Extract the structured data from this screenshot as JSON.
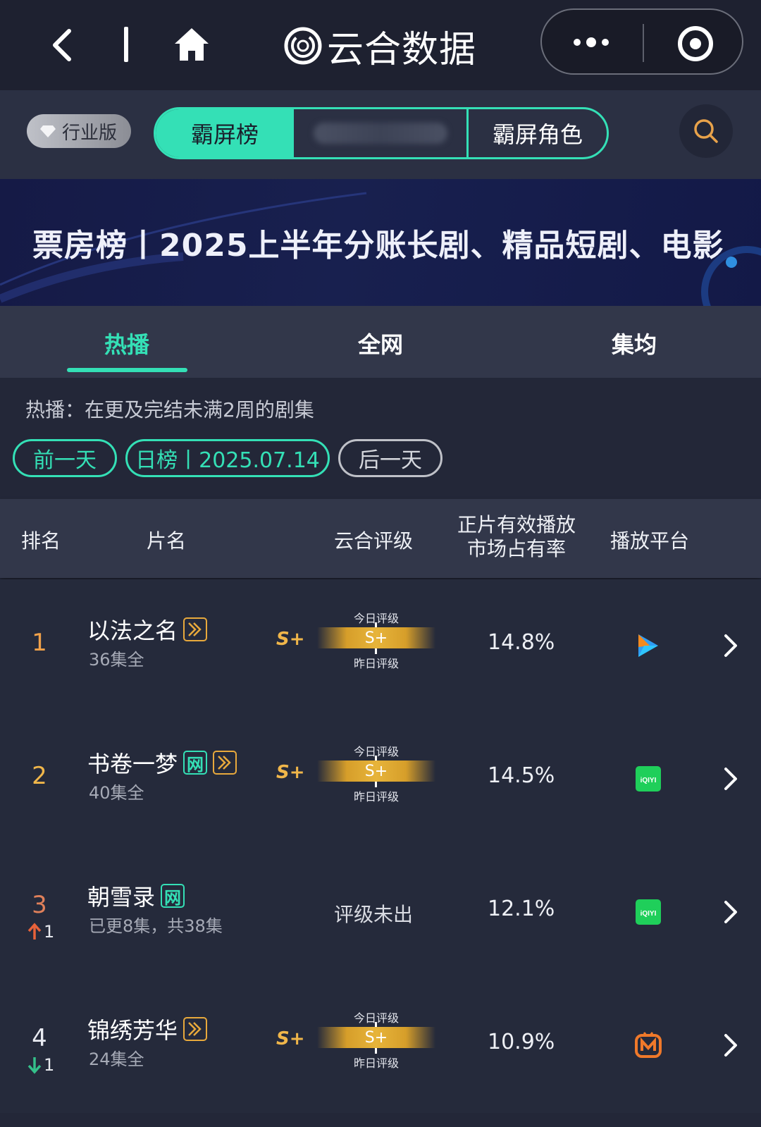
{
  "nav": {
    "app_title": "云合数据"
  },
  "filter": {
    "edition_label": "行业版",
    "segments": [
      "霸屏榜",
      "",
      "霸屏角色"
    ]
  },
  "banner": {
    "text": "票房榜丨2025上半年分账长剧、精品短剧、电影"
  },
  "tabs": [
    "热播",
    "全网",
    "集均"
  ],
  "active_tab": "热播",
  "description": "热播：在更及完结未满2周的剧集",
  "date_nav": {
    "prev_label": "前一天",
    "current_label": "日榜丨2025.07.14",
    "next_label": "后一天"
  },
  "table": {
    "headers": {
      "rank": "排名",
      "title": "片名",
      "rating": "云合评级",
      "share_line1": "正片有效播放",
      "share_line2": "市场占有率",
      "platform": "播放平台"
    },
    "today_label": "今日评级",
    "yesterday_label": "昨日评级",
    "rows": [
      {
        "rank": "1",
        "title": "以法之名",
        "tags": [
          "vip"
        ],
        "episodes": "36集全",
        "grade": "S+",
        "bar_grade": "S+",
        "share": "14.8%",
        "platform": "tencent-video-icon",
        "change": ""
      },
      {
        "rank": "2",
        "title": "书卷一梦",
        "tags": [
          "net",
          "vip"
        ],
        "episodes": "40集全",
        "grade": "S+",
        "bar_grade": "S+",
        "share": "14.5%",
        "platform": "iqiyi-icon",
        "change": ""
      },
      {
        "rank": "3",
        "title": "朝雪录",
        "tags": [
          "net"
        ],
        "episodes": "已更8集，共38集",
        "grade": "",
        "rating_na": "评级未出",
        "share": "12.1%",
        "platform": "iqiyi-icon",
        "change": "1",
        "change_dir": "up"
      },
      {
        "rank": "4",
        "title": "锦绣芳华",
        "tags": [
          "vip"
        ],
        "episodes": "24集全",
        "grade": "S+",
        "bar_grade": "S+",
        "share": "10.9%",
        "platform": "mango-tv-icon",
        "change": "1",
        "change_dir": "down"
      }
    ]
  },
  "tag_text": {
    "net": "网"
  },
  "platform_label": {
    "iqiyi": "iQIYI"
  },
  "colors": {
    "accent": "#34e0b6",
    "grade_gold": "#f0b64a",
    "rank_1": "#f0a14a",
    "rank_2": "#f0b64a",
    "rank_3": "#e0805a",
    "up": "#e8623a",
    "down": "#34c08a"
  }
}
